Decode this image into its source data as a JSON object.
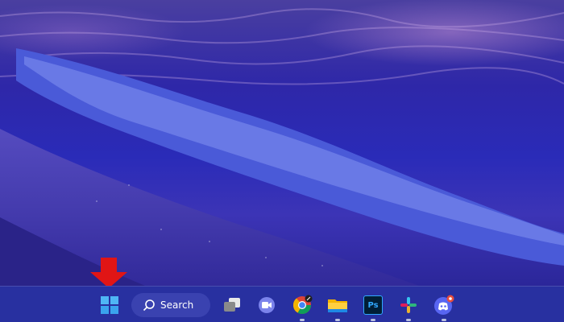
{
  "taskbar": {
    "search_label": "Search",
    "apps": [
      {
        "name": "task-view"
      },
      {
        "name": "teams-chat"
      },
      {
        "name": "chrome"
      },
      {
        "name": "file-explorer"
      },
      {
        "name": "photoshop",
        "label": "Ps"
      },
      {
        "name": "slack"
      },
      {
        "name": "discord"
      }
    ]
  },
  "colors": {
    "taskbar": "#2830a0",
    "accent": "#e11515",
    "windows_logo": "#4fb6f5"
  },
  "annotation": {
    "type": "arrow",
    "color": "#e11515",
    "points_to": "start-button"
  }
}
